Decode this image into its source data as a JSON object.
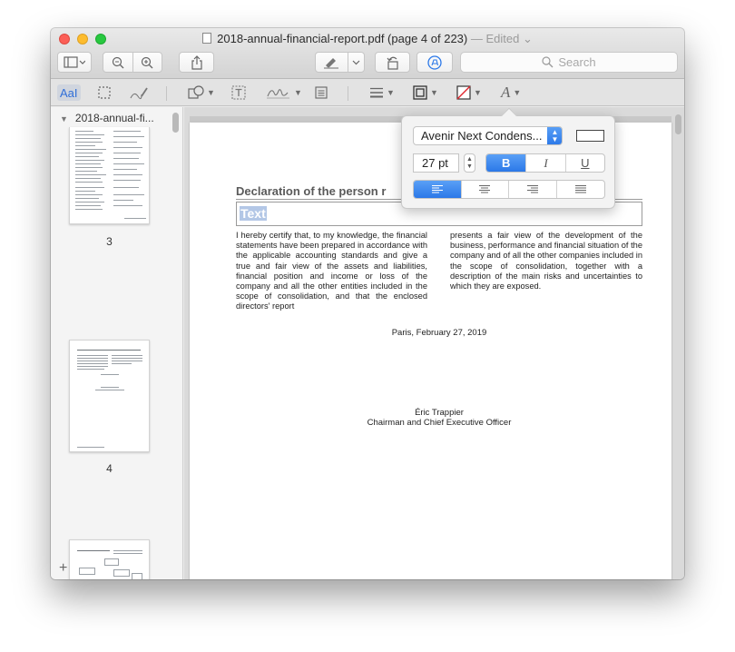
{
  "window": {
    "title": "2018-annual-financial-report.pdf (page 4 of 223)",
    "edited": "— Edited ⌄"
  },
  "toolbar": {
    "search_placeholder": "Search",
    "search_icon": "magnifier-icon"
  },
  "markup": {
    "text_style_label": "AaI"
  },
  "sidebar": {
    "filename": "2018-annual-fi...",
    "pages": [
      {
        "label": "3"
      },
      {
        "label": "4"
      }
    ]
  },
  "document": {
    "heading": "Declaration of the person r",
    "textbox_text": "Text",
    "left_column": "I hereby certify that, to my knowledge, the financial statements have been prepared in accordance with the applicable accounting standards and give a true and fair view of the assets and liabilities, financial position and income or loss of the company and all the other entities included in the scope of consolidation, and that the enclosed directors' report",
    "right_column": "presents a fair view of the development of the business, performance and financial situation of the company and of all the other companies included in the scope of consolidation, together with a description of the main risks and uncertainties to which they are exposed.",
    "place_date": "Paris, February 27, 2019",
    "signatory_name": "Éric Trappier",
    "signatory_title": "Chairman and Chief Executive Officer"
  },
  "text_popover": {
    "font_name": "Avenir Next Condens...",
    "font_size": "27 pt",
    "bold": "B",
    "italic": "I",
    "underline": "U",
    "selected_style": "bold",
    "selected_alignment": "left",
    "text_color": "#ffffff"
  },
  "colors": {
    "accent": "#2b78e8",
    "selection": "#b3c7e6"
  }
}
